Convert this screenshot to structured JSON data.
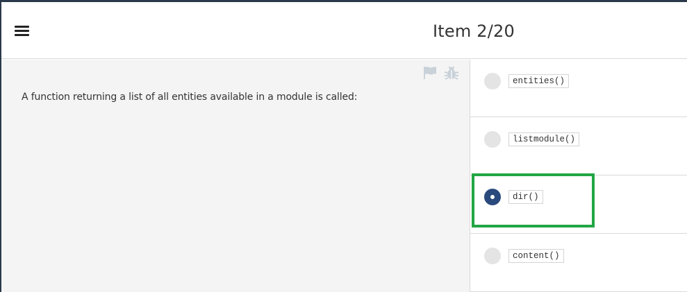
{
  "header": {
    "menu_icon": "hamburger-menu-icon",
    "item_counter": "Item 2/20"
  },
  "question": {
    "text": "A function returning a list of all entities available in a module is called:",
    "icons": [
      "flag-icon",
      "bug-icon"
    ]
  },
  "answers": [
    {
      "label": "entities()",
      "selected": false
    },
    {
      "label": "listmodule()",
      "selected": false
    },
    {
      "label": "dir()",
      "selected": true
    },
    {
      "label": "content()",
      "selected": false
    }
  ],
  "colors": {
    "selected_radio": "#2a4a7d",
    "unselected_radio": "#e4e4e4",
    "highlight": "#22a644",
    "question_bg": "#f4f4f4",
    "top_strip": "#2b3a4a"
  }
}
